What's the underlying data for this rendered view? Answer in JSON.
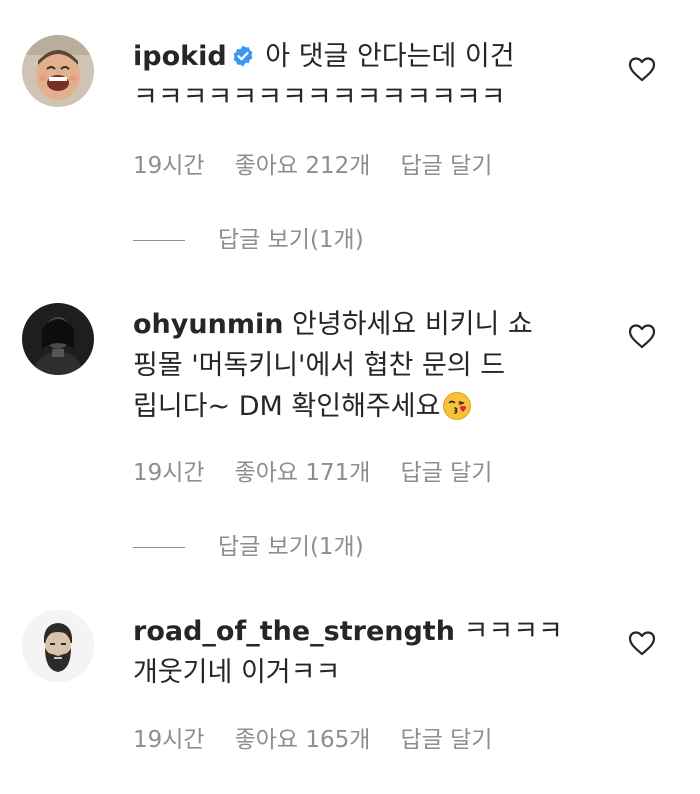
{
  "comments": [
    {
      "username": "ipokid",
      "verified": true,
      "text_line1": "아 댓글 안다는데 이건",
      "text_line2": "ㅋㅋㅋㅋㅋㅋㅋㅋㅋㅋㅋㅋㅋㅋㅋ",
      "time": "19시간",
      "likes": "좋아요 212개",
      "reply_label": "답글 달기",
      "view_replies": "답글 보기(1개)",
      "avatar_icon": "laughing-child-avatar"
    },
    {
      "username": "ohyunmin",
      "verified": false,
      "text_line1": "안녕하세요 비키니 쇼",
      "text_line2": "핑몰 '머독키니'에서 협찬 문의 드",
      "text_line3": "립니다~ DM 확인해주세요",
      "emoji_icon": "face-blowing-kiss-emoji",
      "time": "19시간",
      "likes": "좋아요 171개",
      "reply_label": "답글 달기",
      "view_replies": "답글 보기(1개)",
      "avatar_icon": "dark-portrait-avatar"
    },
    {
      "username": "road_of_the_strength",
      "verified": false,
      "text_line1": "ㅋㅋㅋㅋ",
      "text_line2": "개웃기네 이거ㅋㅋ",
      "time": "19시간",
      "likes": "좋아요 165개",
      "reply_label": "답글 달기",
      "avatar_icon": "bearded-man-avatar"
    }
  ],
  "colors": {
    "text": "#262626",
    "secondary": "#8e8e8e",
    "verified_blue": "#3897f0"
  },
  "icons": {
    "like": "heart-outline-icon",
    "verified": "verified-badge-icon"
  }
}
